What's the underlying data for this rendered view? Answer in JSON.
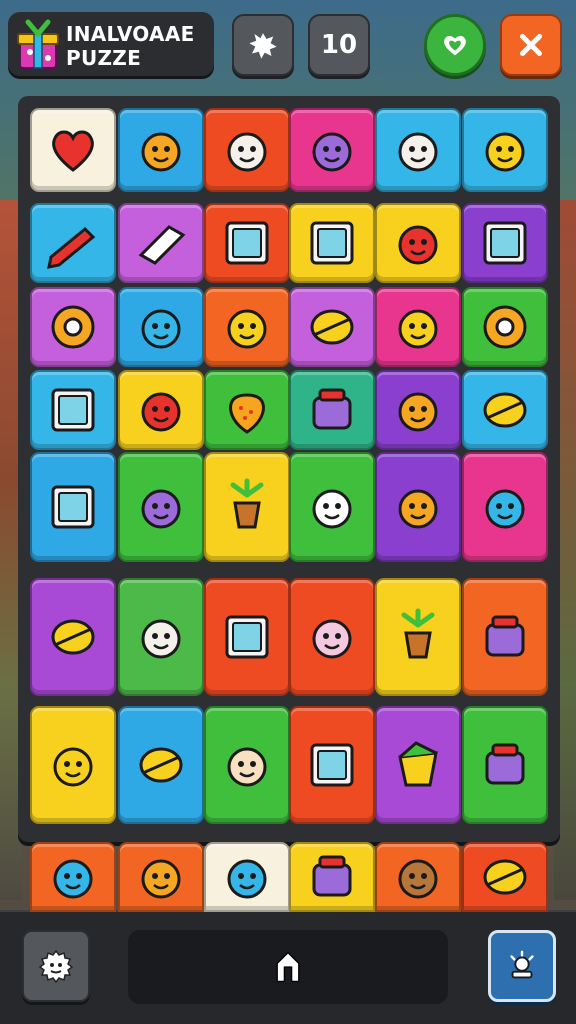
{
  "header": {
    "title_line1": "INALVOAAE",
    "title_line2": "PUZZE",
    "counter_value": "10",
    "colors": {
      "settings": "#54575c",
      "confirm": "#3cb53e",
      "close": "#f26522"
    }
  },
  "board": {
    "rows": [
      [
        {
          "color": "#f8f1de",
          "icon": "heart-icon"
        },
        {
          "color": "#2fa8e6",
          "icon": "monster-icon"
        },
        {
          "color": "#ef4b23",
          "icon": "bear-face-icon"
        },
        {
          "color": "#e8368f",
          "icon": "purple-cat-icon"
        },
        {
          "color": "#35b6e8",
          "icon": "sunglasses-face-icon"
        },
        {
          "color": "#35b6e8",
          "icon": "yellow-creature-icon"
        }
      ],
      [
        {
          "color": "#35b6e8",
          "icon": "red-pencil-icon"
        },
        {
          "color": "#c560dc",
          "icon": "eraser-icon"
        },
        {
          "color": "#ef4b23",
          "icon": "mirror-icon"
        },
        {
          "color": "#f7d11e",
          "icon": "picture-frame-icon"
        },
        {
          "color": "#f7d11e",
          "icon": "red-blob-face-icon"
        },
        {
          "color": "#8a3fcf",
          "icon": "green-box-icon"
        }
      ],
      [
        {
          "color": "#c560dc",
          "icon": "spiral-icon"
        },
        {
          "color": "#2fa8e6",
          "icon": "fish-icon"
        },
        {
          "color": "#f26522",
          "icon": "flower-face-icon"
        },
        {
          "color": "#c560dc",
          "icon": "planet-icon"
        },
        {
          "color": "#e8368f",
          "icon": "yellow-flower-icon"
        },
        {
          "color": "#3fbf3c",
          "icon": "donut-icon"
        }
      ],
      [
        {
          "color": "#35b6e8",
          "icon": "easel-icon"
        },
        {
          "color": "#f7d11e",
          "icon": "red-blob-icon"
        },
        {
          "color": "#3fbf3c",
          "icon": "strawberry-icon"
        },
        {
          "color": "#2fb48a",
          "icon": "jar-icon"
        },
        {
          "color": "#8a3fcf",
          "icon": "lion-face-icon"
        },
        {
          "color": "#35b6e8",
          "icon": "capsule-icon"
        }
      ],
      [
        {
          "color": "#2fa8e6",
          "icon": "tv-icon"
        },
        {
          "color": "#3fbf3c",
          "icon": "purple-monster-icon"
        },
        {
          "color": "#f7d11e",
          "icon": "palm-pot-icon"
        },
        {
          "color": "#3fbf3c",
          "icon": "gnome-icon"
        },
        {
          "color": "#8a3fcf",
          "icon": "yellow-lion-icon"
        },
        {
          "color": "#e8368f",
          "icon": "blue-blob-icon"
        }
      ],
      [
        {
          "color": "#a94ad6",
          "icon": "pin-icon"
        },
        {
          "color": "#4cba48",
          "icon": "bear-icon"
        },
        {
          "color": "#ef4b23",
          "icon": "tablet-icon"
        },
        {
          "color": "#ef4b23",
          "icon": "witch-icon"
        },
        {
          "color": "#f7d11e",
          "icon": "yellow-leaf-icon"
        },
        {
          "color": "#f26522",
          "icon": "bell-icon"
        }
      ],
      [
        {
          "color": "#f7d11e",
          "icon": "yellow-cat-icon"
        },
        {
          "color": "#2fa8e6",
          "icon": "red-balloon-icon"
        },
        {
          "color": "#3fbf3c",
          "icon": "boy-icon"
        },
        {
          "color": "#ef4b23",
          "icon": "notebook-icon"
        },
        {
          "color": "#a94ad6",
          "icon": "cheese-icon"
        },
        {
          "color": "#3fbf3c",
          "icon": "robot-icon"
        }
      ]
    ],
    "bottom_row": [
      {
        "color": "#f26522",
        "icon": "blue-cat-icon"
      },
      {
        "color": "#f26522",
        "icon": "lion-cub-icon"
      },
      {
        "color": "#f8f1de",
        "icon": "blue-bear-icon"
      },
      {
        "color": "#f7d11e",
        "icon": "cup-icon"
      },
      {
        "color": "#f26522",
        "icon": "brown-bear-icon"
      },
      {
        "color": "#ef4b23",
        "icon": "pink-cat-icon"
      }
    ]
  },
  "footer": {
    "left_button_icon": "gear-icon",
    "center_button_icon": "home-icon",
    "right_button_icon": "hint-icon"
  }
}
